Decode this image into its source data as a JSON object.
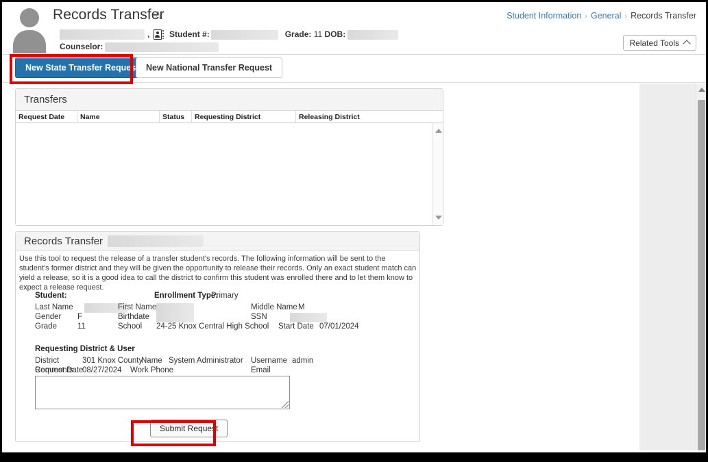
{
  "header": {
    "page_title": "Records Transfer",
    "favorite_icon": "star-icon",
    "student_number_label": "Student #:",
    "grade_label": "Grade:",
    "grade_value": "11",
    "dob_label": "DOB:",
    "counselor_label": "Counselor:",
    "breadcrumb": {
      "item1": "Student Information",
      "item2": "General",
      "current": "Records Transfer",
      "separator": "›"
    },
    "related_tools_label": "Related Tools"
  },
  "tabs": {
    "new_state_transfer": "New State Transfer Request",
    "new_national_transfer": "New National Transfer Request"
  },
  "transfers_panel": {
    "title": "Transfers",
    "columns": [
      "Request Date",
      "Name",
      "Status",
      "Requesting District",
      "Releasing District"
    ],
    "rows": []
  },
  "records_transfer": {
    "title": "Records Transfer",
    "description": "Use this tool to request the release of a transfer student's records. The following information will be sent to the student's former district and they will be given the opportunity to release their records. Only an exact student match can yield a release, so it is a good idea to call the district to confirm this student was enrolled there and to let them know to expect a release request.",
    "student_section": {
      "heading": "Student:",
      "enrollment_type_label": "Enrollment Type:",
      "enrollment_type_value": "Primary",
      "last_name_label": "Last Name",
      "last_name_value": "",
      "first_name_label": "First Name",
      "first_name_value": "",
      "middle_name_label": "Middle Name",
      "middle_name_value": "M",
      "gender_label": "Gender",
      "gender_value": "F",
      "birthdate_label": "Birthdate",
      "birthdate_value": "",
      "ssn_label": "SSN",
      "ssn_value": "",
      "grade_label": "Grade",
      "grade_value": "11",
      "school_label": "School",
      "school_value": "24-25 Knox Central High School",
      "start_date_label": "Start Date",
      "start_date_value": "07/01/2024"
    },
    "district_section": {
      "heading": "Requesting District & User",
      "district_label": "District",
      "district_value": "301 Knox County",
      "name_label": "Name",
      "name_value": "System Administrator",
      "username_label": "Username",
      "username_value": "admin",
      "request_date_label": "Request Date",
      "request_date_value": "08/27/2024",
      "work_phone_label": "Work Phone",
      "work_phone_value": "",
      "email_label": "Email",
      "email_value": "",
      "comments_label": "Comments",
      "comments_value": "",
      "comments_placeholder": ""
    },
    "submit_label": "Submit Request"
  },
  "annotations": {
    "highlight_color": "#e00000",
    "boxes": [
      "new-state-transfer-request",
      "submit-request"
    ]
  },
  "colors": {
    "primary_button": "#2272ad",
    "link": "#3a7cb5",
    "panel_header": "#f4f4f4",
    "page_background": "#ededed"
  }
}
